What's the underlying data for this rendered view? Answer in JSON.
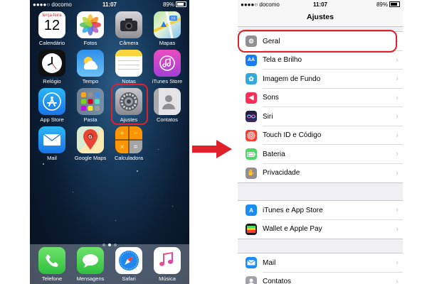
{
  "home_screen": {
    "status_bar": {
      "carrier": "docomo",
      "time": "11:07",
      "battery": "89%"
    },
    "calendar": {
      "weekday": "terça-feira",
      "day": "12"
    },
    "apps": [
      {
        "label": "Calendário",
        "icon": "calendar-icon"
      },
      {
        "label": "Fotos",
        "icon": "photos-icon"
      },
      {
        "label": "Câmera",
        "icon": "camera-icon"
      },
      {
        "label": "Mapas",
        "icon": "maps-icon"
      },
      {
        "label": "Relógio",
        "icon": "clock-icon"
      },
      {
        "label": "Tempo",
        "icon": "weather-icon"
      },
      {
        "label": "Notas",
        "icon": "notes-icon"
      },
      {
        "label": "iTunes Store",
        "icon": "itunes-store-icon"
      },
      {
        "label": "App Store",
        "icon": "app-store-icon"
      },
      {
        "label": "Pasta",
        "icon": "folder-icon"
      },
      {
        "label": "Ajustes",
        "icon": "settings-gear-icon"
      },
      {
        "label": "Contatos",
        "icon": "contacts-icon"
      },
      {
        "label": "Mail",
        "icon": "mail-icon"
      },
      {
        "label": "Google Maps",
        "icon": "google-maps-icon"
      },
      {
        "label": "Calculadora",
        "icon": "calculator-icon"
      }
    ],
    "dock": [
      {
        "label": "Telefone",
        "icon": "phone-icon"
      },
      {
        "label": "Mensagens",
        "icon": "messages-icon"
      },
      {
        "label": "Safari",
        "icon": "safari-icon"
      },
      {
        "label": "Música",
        "icon": "music-icon"
      }
    ],
    "page_dots": {
      "count": 3,
      "active": 2
    },
    "highlighted_app": "Ajustes"
  },
  "settings_screen": {
    "status_bar": {
      "carrier": "docomo",
      "time": "11:07",
      "battery": "89%"
    },
    "title": "Ajustes",
    "groups": [
      [
        {
          "label": "Geral",
          "icon": "gear-icon",
          "color": "#8e8e93"
        },
        {
          "label": "Tela e Brilho",
          "icon": "text-size-icon",
          "color": "#1a7cf5"
        },
        {
          "label": "Imagem de Fundo",
          "icon": "wallpaper-icon",
          "color": "#34aadc"
        },
        {
          "label": "Sons",
          "icon": "speaker-icon",
          "color": "#ff2d55"
        },
        {
          "label": "Siri",
          "icon": "siri-icon",
          "color": "#1c1c3a"
        },
        {
          "label": "Touch ID e Código",
          "icon": "fingerprint-icon",
          "color": "#ff3b30"
        },
        {
          "label": "Bateria",
          "icon": "battery-icon",
          "color": "#4cd964"
        },
        {
          "label": "Privacidade",
          "icon": "hand-icon",
          "color": "#8e8e93"
        }
      ],
      [
        {
          "label": "iTunes e App Store",
          "icon": "app-store-icon",
          "color": "#1a8cf5"
        },
        {
          "label": "Wallet e Apple Pay",
          "icon": "wallet-icon",
          "color": "#1c1c1e"
        }
      ],
      [
        {
          "label": "Mail",
          "icon": "mail-icon",
          "color": "#1a8cf5"
        },
        {
          "label": "Contatos",
          "icon": "contacts-icon",
          "color": "#a0a0a8"
        }
      ]
    ],
    "highlighted_row": "Geral"
  },
  "colors": {
    "highlight": "#e0212b",
    "arrow": "#e0212b"
  }
}
